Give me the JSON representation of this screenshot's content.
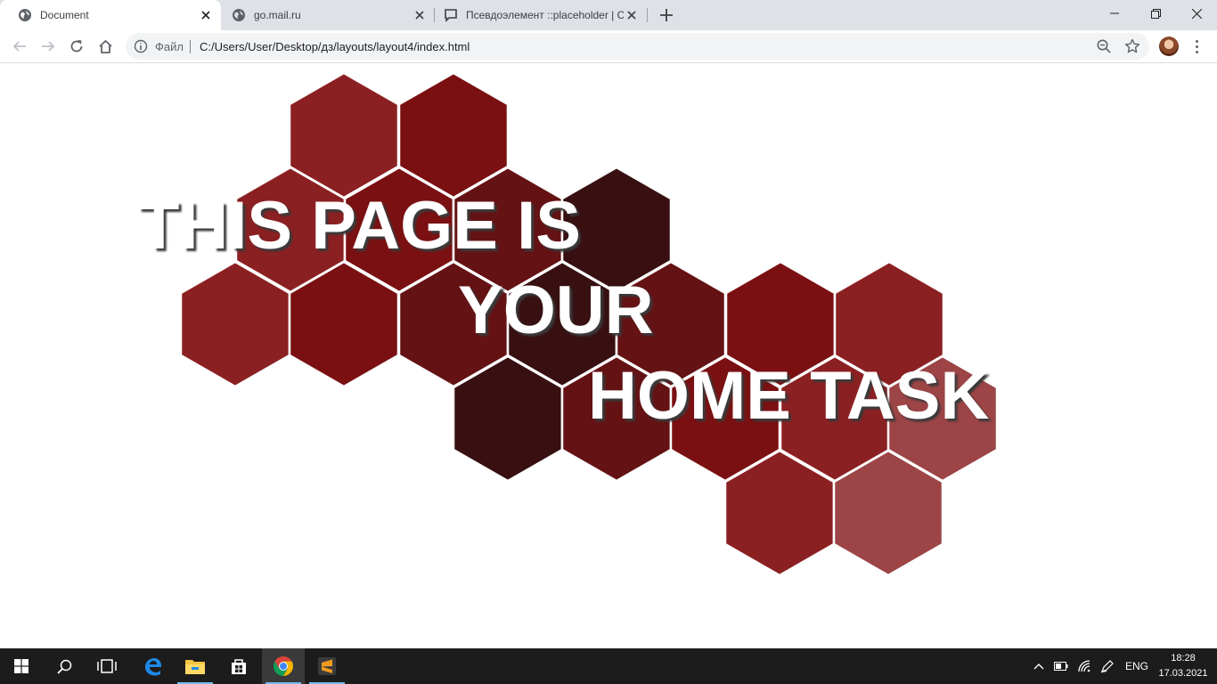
{
  "browser": {
    "tabs": [
      {
        "title": "Document",
        "favicon": "globe-icon",
        "active": true
      },
      {
        "title": "go.mail.ru",
        "favicon": "globe-icon",
        "active": false
      },
      {
        "title": "Псевдоэлемент ::placeholder | C",
        "favicon": "chat-bubble-icon",
        "active": false
      }
    ],
    "omnibox": {
      "security_label": "Файл",
      "url": "C:/Users/User/Desktop/дз/layouts/layout4/index.html"
    }
  },
  "page": {
    "headline_lines": [
      "THIS PAGE IS",
      "YOUR",
      "HOME TASK"
    ],
    "hex_colors": [
      "#8b2022",
      "#7a1012",
      "#641214",
      "#381012",
      "#9c4446"
    ]
  },
  "taskbar": {
    "apps": [
      "start-icon",
      "search-icon",
      "task-view-icon",
      "edge-icon",
      "file-explorer-icon",
      "store-icon",
      "chrome-icon",
      "sublime-text-icon"
    ],
    "language": "ENG",
    "time": "18:28",
    "date": "17.03.2021"
  }
}
